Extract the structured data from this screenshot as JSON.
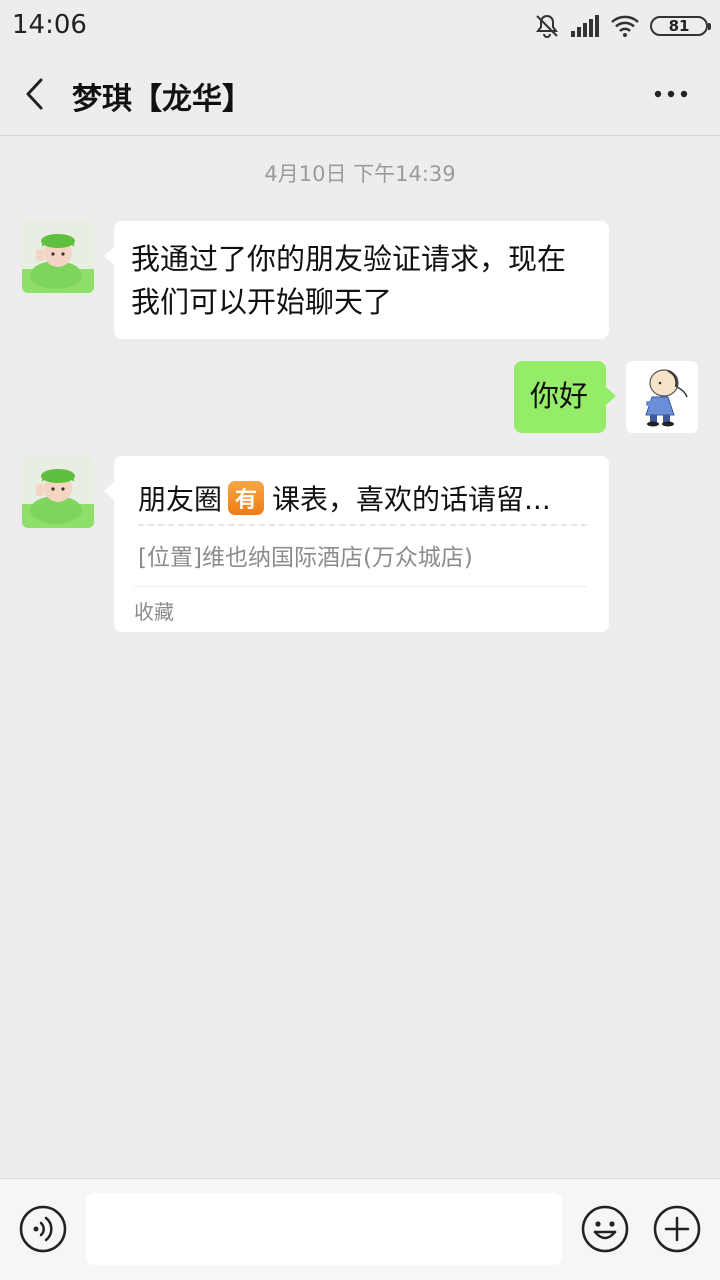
{
  "status": {
    "time": "14:06",
    "battery": "81",
    "icons": [
      "mute-icon",
      "signal-icon",
      "wifi-icon",
      "battery-icon"
    ]
  },
  "header": {
    "title": "梦琪【龙华】",
    "back_icon": "chevron-left-icon",
    "more_icon": "more-dots-icon"
  },
  "chat": {
    "timestamp": "4月10日 下午14:39",
    "messages": [
      {
        "side": "left",
        "lines": [
          "我通过了你的朋友验证请求，现在",
          "我们可以开始聊天了"
        ]
      },
      {
        "side": "right",
        "text": "你好"
      }
    ],
    "card": {
      "title_prefix": "朋友圈",
      "badge": "有",
      "title_suffix": "课表，喜欢的话请留...",
      "subtitle": "[位置]维也纳国际酒店(万众城店)",
      "footer": "收藏"
    }
  },
  "input": {
    "placeholder": "",
    "voice_icon": "voice-icon",
    "emoji_icon": "emoji-icon",
    "plus_icon": "plus-icon"
  },
  "colors": {
    "background": "#ededed",
    "sent_bubble": "#95ec69",
    "received_bubble": "#ffffff"
  }
}
